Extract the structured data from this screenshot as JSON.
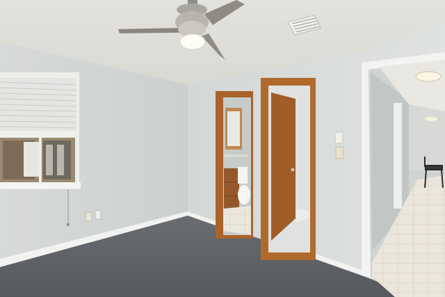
{
  "scene": {
    "description_tags": [
      "empty-bedroom",
      "ceiling-fan",
      "window-with-blinds",
      "bathroom-door",
      "closet-door",
      "hallway",
      "carpet",
      "tile-floor"
    ],
    "watermark": ""
  },
  "colors": {
    "wall": "#d6dad8",
    "ceiling": "#e2e1dc",
    "carpet": "#5f6266",
    "trim": "#f4f4f2",
    "wood": "#b06a2c",
    "door_wood": "#a25f29",
    "tile": "#e9e4da"
  }
}
